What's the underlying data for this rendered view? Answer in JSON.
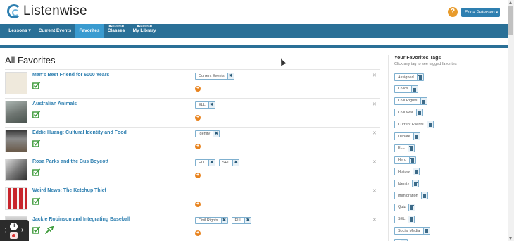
{
  "header": {
    "logo_text": "Listenwise",
    "help_symbol": "?",
    "user_name": "Erica Petersen"
  },
  "nav": {
    "items": [
      {
        "label": "Lessons",
        "dropdown": true,
        "badge": ""
      },
      {
        "label": "Current Events",
        "dropdown": false,
        "badge": ""
      },
      {
        "label": "Favorites",
        "dropdown": false,
        "badge": "",
        "active": true
      },
      {
        "label": "Classes",
        "dropdown": false,
        "badge": "PREMIUM"
      },
      {
        "label": "My Library",
        "dropdown": false,
        "badge": "PREMIUM"
      }
    ]
  },
  "main": {
    "title": "All Favorites",
    "rows": [
      {
        "title": "Man's Best Friend for 6000 Years",
        "tags": [
          "Current Events"
        ],
        "thumb": "sketch",
        "extra_icon": false
      },
      {
        "title": "Australian Animals",
        "tags": [
          "ELL"
        ],
        "thumb": "koala",
        "extra_icon": false
      },
      {
        "title": "Eddie Huang: Cultural Identity and Food",
        "tags": [
          "Idenity"
        ],
        "thumb": "portrait",
        "extra_icon": false
      },
      {
        "title": "Rosa Parks and the Bus Boycott",
        "tags": [
          "ELL",
          "SEL"
        ],
        "thumb": "bw-photo",
        "extra_icon": false
      },
      {
        "title": "Weird News: The Ketchup Thief",
        "tags": [],
        "thumb": "ketchup",
        "extra_icon": false
      },
      {
        "title": "Jackie Robinson and Integrating Baseball",
        "tags": [
          "Civil Rights",
          "ELL"
        ],
        "thumb": "baseball",
        "extra_icon": true
      }
    ]
  },
  "sidebar": {
    "title": "Your Favorites Tags",
    "subtitle": "Click any tag to see tagged favorites",
    "tags": [
      "Assigned",
      "Civics",
      "Civil Rights",
      "Civil War",
      "Current Events",
      "Debate",
      "ELL",
      "Hero",
      "History",
      "Idenity",
      "Immigration",
      "Quiz",
      "SEL",
      "Social Media",
      ""
    ]
  },
  "colors": {
    "nav_bg": "#2a7097",
    "nav_active": "#3a9bd0",
    "link": "#2e7fb0",
    "add_orange": "#e8831e",
    "assign_green": "#3d9a3a"
  },
  "widget": {
    "pause_symbol": "II",
    "arrow_symbol": "›",
    "grip_symbol": "⋮"
  }
}
